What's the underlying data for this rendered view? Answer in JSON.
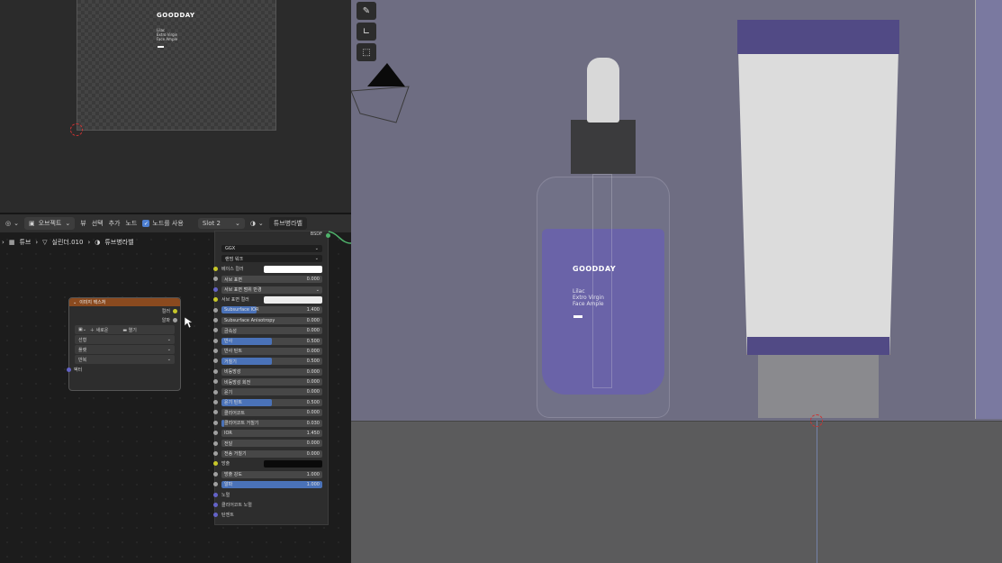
{
  "texture_preview": {
    "brand": "GOODDAY",
    "lines": [
      "Lilac",
      "Extro Virgin",
      "Face Ample"
    ]
  },
  "node_header": {
    "view_mode": "오브젝트",
    "menus": [
      "뷰",
      "선택",
      "추가",
      "노드"
    ],
    "use_nodes_label": "노드를 사용",
    "slot": "Slot 2",
    "material": "튜브병라벨"
  },
  "breadcrumb": [
    "튜브",
    "실린더.010",
    "튜브병라벨"
  ],
  "tex_node": {
    "title": "이미지 텍스처",
    "out_color": "컬러",
    "out_alpha": "알파",
    "new_label": "새로운",
    "open_label": "열기",
    "interp": "선형",
    "proj": "플랫",
    "ext": "반복",
    "vector": "벡터"
  },
  "bsdf": {
    "output_label": "BSDF",
    "distribution": "GGX",
    "subsurface_method": "랜덤 워크",
    "rows": [
      {
        "label": "베이스 컬러",
        "kind": "swatch",
        "color": "#ffffff"
      },
      {
        "label": "서브 표면",
        "value": "0.000",
        "fill": 0
      },
      {
        "label": "서브 표면 범위 반경",
        "kind": "drop"
      },
      {
        "label": "서브 표면 컬러",
        "kind": "swatch",
        "color": "#ededed"
      },
      {
        "label": "Subsurface IOR",
        "value": "1.400",
        "fill": 0.35
      },
      {
        "label": "Subsurface Anisotropy",
        "value": "0.000",
        "fill": 0
      },
      {
        "label": "금속성",
        "value": "0.000",
        "fill": 0
      },
      {
        "label": "반사",
        "value": "0.500",
        "fill": 0.5
      },
      {
        "label": "반사 틴트",
        "value": "0.000",
        "fill": 0
      },
      {
        "label": "거칠기",
        "value": "0.500",
        "fill": 0.5
      },
      {
        "label": "비등방성",
        "value": "0.000",
        "fill": 0
      },
      {
        "label": "비등방성 회전",
        "value": "0.000",
        "fill": 0
      },
      {
        "label": "윤기",
        "value": "0.000",
        "fill": 0
      },
      {
        "label": "윤기 틴트",
        "value": "0.500",
        "fill": 0.5
      },
      {
        "label": "클리어코트",
        "value": "0.000",
        "fill": 0
      },
      {
        "label": "클리어코트 거칠기",
        "value": "0.030",
        "fill": 0.03
      },
      {
        "label": "IOR",
        "value": "1.450",
        "fill": 0
      },
      {
        "label": "전달",
        "value": "0.000",
        "fill": 0
      },
      {
        "label": "전송 거칠기",
        "value": "0.000",
        "fill": 0
      },
      {
        "label": "방출",
        "kind": "swatch",
        "color": "#0a0a0a"
      },
      {
        "label": "방출 강도",
        "value": "1.000",
        "fill": 0
      },
      {
        "label": "알파",
        "value": "1.000",
        "fill": 1
      },
      {
        "label": "노멀",
        "kind": "input"
      },
      {
        "label": "클리어코트 노멀",
        "kind": "input"
      },
      {
        "label": "탄젠트",
        "kind": "input"
      }
    ]
  },
  "bottle_label": {
    "brand": "GOODDAY",
    "lines": [
      "Lilac",
      "Extro Virgin",
      "Face Ample"
    ]
  },
  "colors": {
    "accent": "#4a72b8",
    "texture_node": "#8a4a1f",
    "selection": "#e29a3c",
    "label_purple": "#514a85"
  }
}
